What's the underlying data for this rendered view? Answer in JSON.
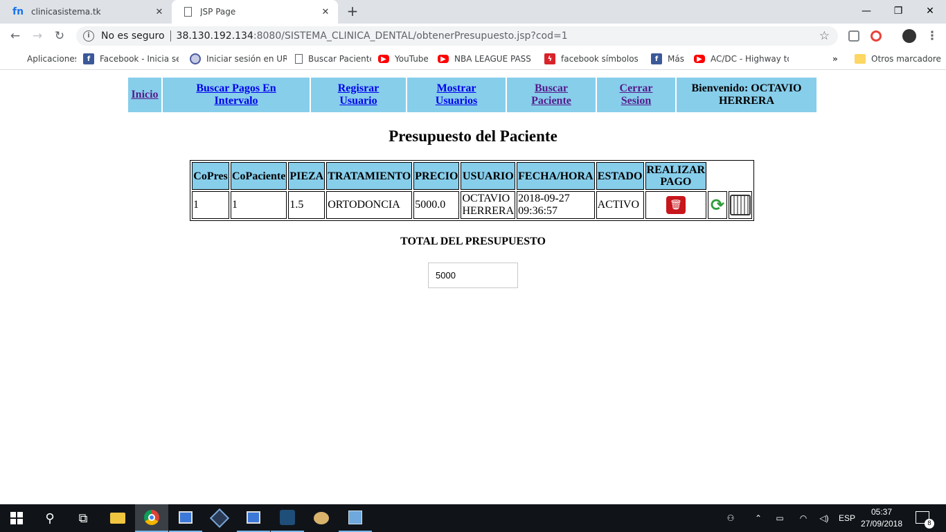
{
  "browser": {
    "tabs": [
      {
        "title": "clinicasistema.tk",
        "favicon": "fn-logo-icon"
      },
      {
        "title": "JSP Page",
        "favicon": "page-icon"
      }
    ],
    "new_tab": "+",
    "window_controls": {
      "minimize": "—",
      "restore": "❐",
      "close": "✕"
    },
    "address": {
      "security": "No es seguro",
      "host": "38.130.192.134",
      "rest": ":8080/SISTEMA_CLINICA_DENTAL/obtenerPresupuesto.jsp?cod=1"
    },
    "bookmarks": [
      {
        "label": "Aplicaciones",
        "icon": "apps-grid-icon"
      },
      {
        "label": "Facebook - Inicia sesi",
        "icon": "facebook-icon"
      },
      {
        "label": "Iniciar sesión en URL",
        "icon": "globe-icon"
      },
      {
        "label": "Buscar Paciente",
        "icon": "page-icon"
      },
      {
        "label": "YouTube",
        "icon": "youtube-icon"
      },
      {
        "label": "NBA LEAGUE PASS H",
        "icon": "youtube-icon"
      },
      {
        "label": "facebook símbolos: e",
        "icon": "flash-icon"
      },
      {
        "label": "Más",
        "icon": "facebook-icon"
      },
      {
        "label": "AC/DC - Highway to",
        "icon": "youtube-icon"
      }
    ],
    "bookmarks_overflow": "»",
    "other_bookmarks": "Otros marcadores"
  },
  "nav": {
    "items": [
      {
        "label": "Inicio"
      },
      {
        "label": "Buscar Pagos En Intervalo"
      },
      {
        "label": "Regisrar Usuario"
      },
      {
        "label": "Mostrar Usuarios"
      },
      {
        "label": "Buscar Paciente"
      },
      {
        "label": "Cerrar Sesion"
      }
    ],
    "welcome_line1": "Bienvenido: OCTAVIO",
    "welcome_line2": "HERRERA"
  },
  "page_title": "Presupuesto del Paciente",
  "table": {
    "headers": [
      "CoPres",
      "CoPaciente",
      "PIEZA",
      "TRATAMIENTO",
      "PRECIO",
      "USUARIO",
      "FECHA/HORA",
      "ESTADO"
    ],
    "pay_header_line1": "REALIZAR",
    "pay_header_line2": "PAGO",
    "row": {
      "copres": "1",
      "copaciente": "1",
      "pieza": "1.5",
      "tratamiento": "ORTODONCIA",
      "precio": "5000.0",
      "usuario_line1": "OCTAVIO",
      "usuario_line2": "HERRERA",
      "fecha_line1": "2018-09-27",
      "fecha_line2": "09:36:57",
      "estado": "ACTIVO"
    },
    "actions": {
      "pay_icon": "trash-icon",
      "refresh_icon": "refresh-icon",
      "print_icon": "printer-icon"
    }
  },
  "total": {
    "label": "TOTAL DEL PRESUPUESTO",
    "value": "5000"
  },
  "taskbar": {
    "language": "ESP",
    "time": "05:37",
    "date": "27/09/2018",
    "notifications": "8"
  },
  "colors": {
    "header_bg": "#87ceeb",
    "link": "#0000ee",
    "visited_link": "#551a8b",
    "taskbar": "#101419"
  }
}
